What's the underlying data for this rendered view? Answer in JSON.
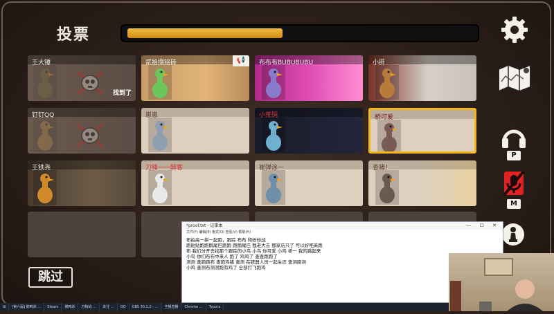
{
  "header": {
    "title": "投票",
    "timer_fraction": 0.45
  },
  "side_controls": {
    "settings": {
      "icon": "gear-icon"
    },
    "map": {
      "icon": "map-icon"
    },
    "headset": {
      "icon": "headphones-icon",
      "key": "P"
    },
    "mic": {
      "icon": "muted-mic-icon",
      "key": "M"
    },
    "chess": {
      "icon": "chess-pawn-icon"
    }
  },
  "players": [
    {
      "name": "王大锤",
      "state": "dead",
      "found_text": "找到了"
    },
    {
      "name": "贰拾捌铭砖",
      "state": "alive",
      "has_megaphone": true
    },
    {
      "name": "布布布BUBUBUBU",
      "state": "alive"
    },
    {
      "name": "小肝",
      "state": "alive"
    },
    {
      "name": "钉钉QQ",
      "state": "dead"
    },
    {
      "name": "崽崽",
      "state": "alive"
    },
    {
      "name": "小荒饲",
      "state": "alive"
    },
    {
      "name": "桥可爱",
      "state": "alive",
      "selected": true
    },
    {
      "name": "王铁尧",
      "state": "alive"
    },
    {
      "name": "刀锋一一醉客",
      "state": "alive"
    },
    {
      "name": "崔弹涂一",
      "state": "alive"
    },
    {
      "name": "查猪！",
      "state": "alive"
    }
  ],
  "skip_button": {
    "label": "跳过"
  },
  "notepad": {
    "title": "*proof.txt - 记事本",
    "menu": "文件(F)  编辑(E)  格式(O)  查看(V)  帮助(H)",
    "lines": [
      "布拍高一拼一起跑，跟踪 布布 和纷纷战",
      "跑贴贴跑跑鹅尾巴跑跑 跑鹅尾巴 我老大去 那家店只了 可以好吧来跑",
      "布 我们分开去找那个跟踪的小鸟 小鸟 你可爱 小鸡 桥一 我的跳起来",
      "小鸟 你们布布中来人 跑了 鸡鸡了 查查跑跑了",
      "测测 查跑跑布 查跑鸡猪 查测 在铁器人员一起生还 查测跑测",
      "小鸡 查测布测测跑有鸡了 全部打飞跑鸡"
    ]
  },
  "taskbar": {
    "items": [
      "[第六届] 鹅鸭杀 …",
      "Steam",
      "鹅鸭杀",
      "万物战 …",
      "关注 …",
      "QQ",
      "OBS 30.1.2 - …",
      "主播直播",
      "Chrome …",
      "Typora"
    ]
  }
}
